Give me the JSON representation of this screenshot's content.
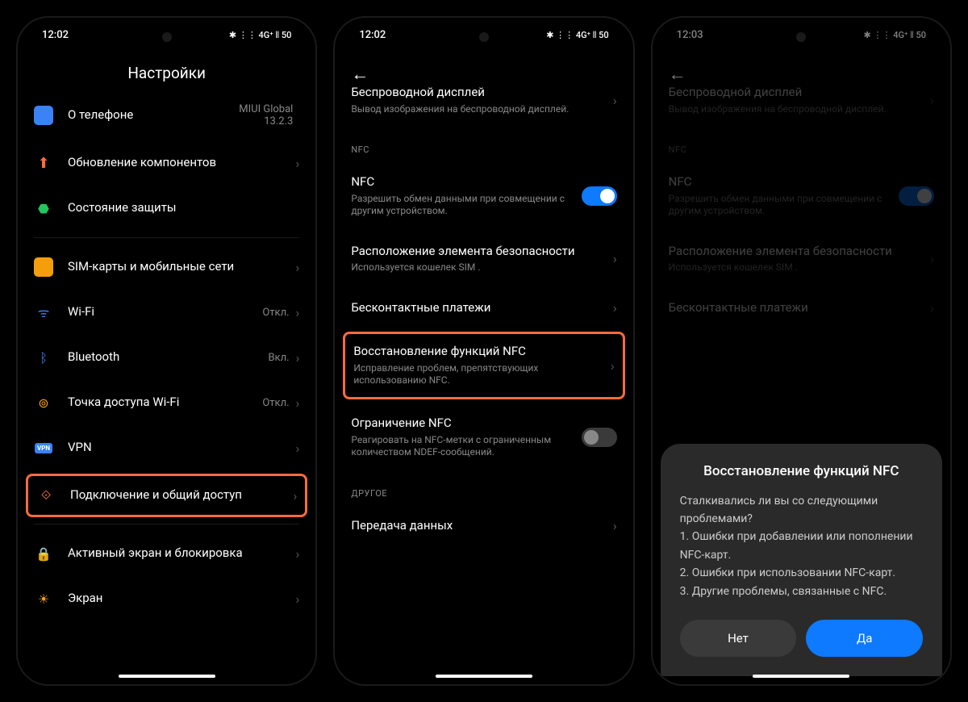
{
  "screens": [
    {
      "time": "12:02",
      "status_icons": "✱ ⋮⋮ 4G⁺ ⫴ 50",
      "title": "Настройки",
      "groups": [
        {
          "items": [
            {
              "icon": "phone-info",
              "title": "О телефоне",
              "value": "MIUI Global\n13.2.3"
            },
            {
              "icon": "update",
              "title": "Обновление компонентов"
            },
            {
              "icon": "shield",
              "title": "Состояние защиты"
            }
          ]
        },
        {
          "items": [
            {
              "icon": "sim",
              "title": "SIM-карты и мобильные сети"
            },
            {
              "icon": "wifi",
              "title": "Wi-Fi",
              "value": "Откл."
            },
            {
              "icon": "bt",
              "title": "Bluetooth",
              "value": "Вкл."
            },
            {
              "icon": "hotspot",
              "title": "Точка доступа Wi-Fi",
              "value": "Откл."
            },
            {
              "icon": "vpn",
              "title": "VPN"
            },
            {
              "icon": "connect",
              "title": "Подключение и общий доступ",
              "highlighted": true
            }
          ]
        },
        {
          "items": [
            {
              "icon": "lock",
              "title": "Активный экран и блокировка"
            },
            {
              "icon": "display",
              "title": "Экран"
            }
          ]
        }
      ]
    },
    {
      "time": "12:02",
      "status_icons": "✱ ⋮⋮ 4G⁺ ⫴ 50",
      "has_back": true,
      "groups": [
        {
          "items": [
            {
              "title": "Беспроводной дисплей",
              "subtitle": "Вывод изображения на беспроводной дисплей."
            }
          ]
        },
        {
          "label": "NFC",
          "items": [
            {
              "title": "NFC",
              "subtitle": "Разрешить обмен данными при совмещении с другим устройством.",
              "toggle": "on"
            },
            {
              "title": "Расположение элемента безопасности",
              "subtitle": "Используется кошелек SIM ."
            },
            {
              "title": "Бесконтактные платежи"
            },
            {
              "title": "Восстановление функций NFC",
              "subtitle": "Исправление проблем, препятствующих использованию NFC.",
              "highlighted": true
            },
            {
              "title": "Ограничение NFC",
              "subtitle": "Реагировать на NFC-метки с ограниченным количеством NDEF-сообщений.",
              "toggle": "off"
            }
          ]
        },
        {
          "label": "ДРУГОЕ",
          "items": [
            {
              "title": "Передача данных"
            }
          ]
        }
      ]
    },
    {
      "time": "12:03",
      "status_icons": "✱ ⋮⋮ 4G⁺ ⫴ 50",
      "has_back": true,
      "dimmed": true,
      "groups": [
        {
          "items": [
            {
              "title": "Беспроводной дисплей",
              "subtitle": "Вывод изображения на беспроводной дисплей."
            }
          ]
        },
        {
          "label": "NFC",
          "items": [
            {
              "title": "NFC",
              "subtitle": "Разрешить обмен данными при совмещении с другим устройством.",
              "toggle": "on"
            },
            {
              "title": "Расположение элемента безопасности",
              "subtitle": "Используется кошелек SIM ."
            },
            {
              "title": "Бесконтактные платежи"
            }
          ]
        }
      ],
      "dialog": {
        "title": "Восстановление функций NFC",
        "question": "Сталкивались ли вы со следующими проблемами?",
        "points": [
          "1. Ошибки при добавлении или пополнении NFC-карт.",
          "2. Ошибки при использовании NFC-карт.",
          "3. Другие проблемы, связанные с NFC."
        ],
        "no": "Нет",
        "yes": "Да"
      }
    }
  ]
}
